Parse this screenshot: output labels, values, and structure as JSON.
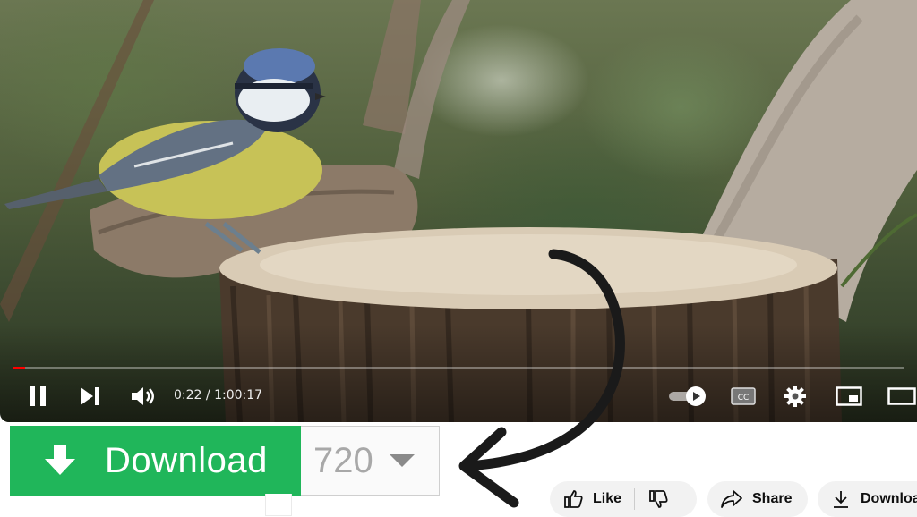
{
  "player": {
    "current_time": "0:22",
    "time_separator": " / ",
    "duration": "1:00:17",
    "progress_fraction": 0.006,
    "autoplay_on": true,
    "icons": [
      "pause-icon",
      "next-icon",
      "volume-icon",
      "autoplay-toggle-icon",
      "cc-icon",
      "settings-gear-icon",
      "miniplayer-icon",
      "theater-mode-icon"
    ]
  },
  "download_widget": {
    "button_label": "Download",
    "quality_value": "720",
    "icons": [
      "download-arrow-icon",
      "dropdown-caret-icon"
    ],
    "colors": {
      "button": "#20b65a",
      "quality_text": "#a8a8a8"
    }
  },
  "actions": {
    "like_label": "Like",
    "share_label": "Share",
    "download_label": "Download",
    "icons": [
      "thumbs-up-icon",
      "thumbs-down-icon",
      "share-arrow-icon",
      "download-icon"
    ]
  },
  "annotation": {
    "type": "curved-arrow",
    "color": "#1a1a1a"
  }
}
